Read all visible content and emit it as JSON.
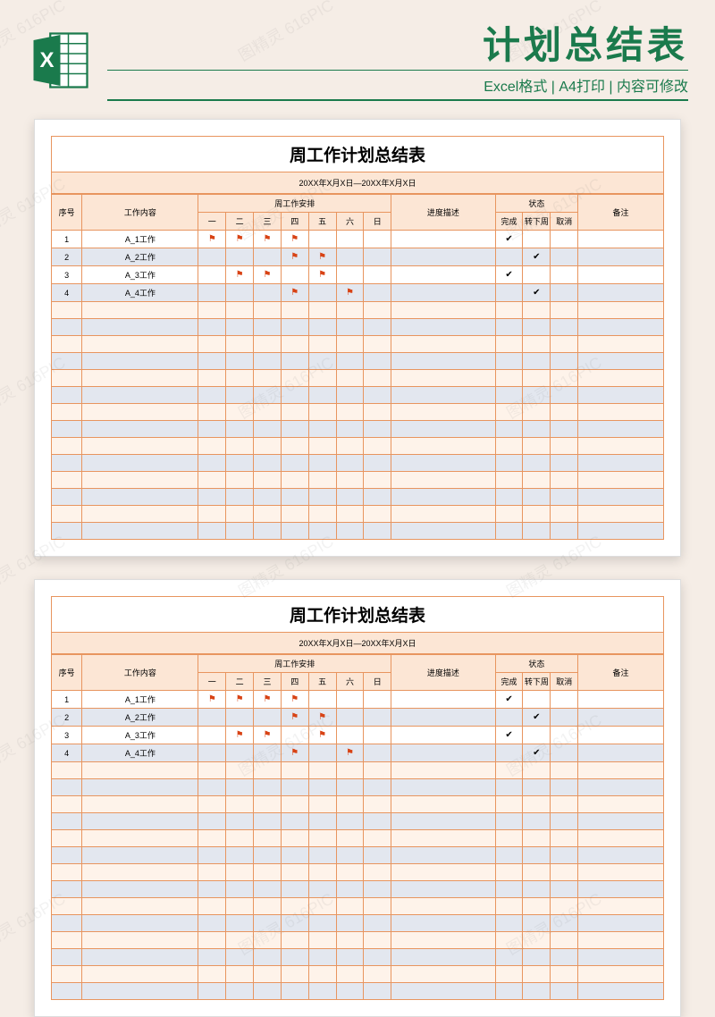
{
  "header": {
    "main_title": "计划总结表",
    "sub_title": "Excel格式 | A4打印 | 内容可修改"
  },
  "watermark": "图精灵 616PIC",
  "table": {
    "title": "周工作计划总结表",
    "date_range": "20XX年X月X日—20XX年X月X日",
    "headers": {
      "seq": "序号",
      "content": "工作内容",
      "schedule_group": "周工作安排",
      "days": [
        "一",
        "二",
        "三",
        "四",
        "五",
        "六",
        "日"
      ],
      "progress": "进度描述",
      "status_group": "状态",
      "statuses": [
        "完成",
        "转下周",
        "取消"
      ],
      "remark": "备注"
    },
    "rows": [
      {
        "seq": "1",
        "content": "A_1工作",
        "days": [
          true,
          true,
          true,
          true,
          false,
          false,
          false
        ],
        "status": [
          true,
          false,
          false
        ]
      },
      {
        "seq": "2",
        "content": "A_2工作",
        "days": [
          false,
          false,
          false,
          true,
          true,
          false,
          false
        ],
        "status": [
          false,
          true,
          false
        ]
      },
      {
        "seq": "3",
        "content": "A_3工作",
        "days": [
          false,
          true,
          true,
          false,
          true,
          false,
          false
        ],
        "status": [
          true,
          false,
          false
        ]
      },
      {
        "seq": "4",
        "content": "A_4工作",
        "days": [
          false,
          false,
          false,
          true,
          false,
          true,
          false
        ],
        "status": [
          false,
          true,
          false
        ]
      }
    ],
    "empty_rows": 14
  }
}
